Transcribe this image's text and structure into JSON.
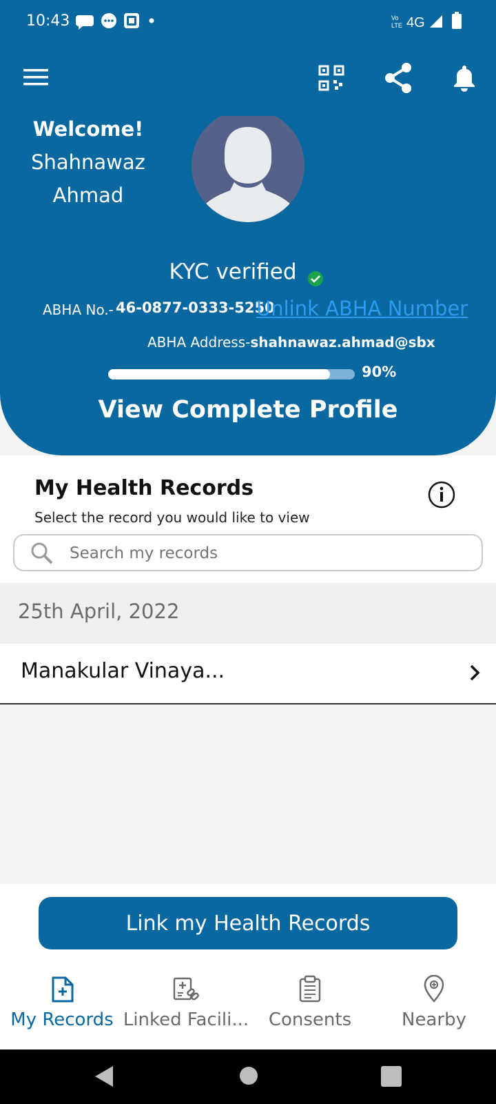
{
  "status_bar": {
    "time": "10:43",
    "network": "4G"
  },
  "profile": {
    "welcome": "Welcome!",
    "first_name": "Shahnawaz",
    "last_name": "Ahmad",
    "kyc": "KYC verified",
    "abha_no_label": "ABHA No.-",
    "abha_no": "46-0877-0333-5250",
    "unlink_label": "Unlink ABHA Number",
    "abha_address_label": "ABHA Address-",
    "abha_address": "shahnawaz.ahmad@sbx",
    "completion_percent": 90,
    "completion_label": "90%",
    "view_profile": "View Complete Profile"
  },
  "records": {
    "title": "My Health Records",
    "subtitle": "Select the record you would like to view",
    "search_placeholder": "Search my records",
    "groups": [
      {
        "date": "25th April, 2022",
        "items": [
          {
            "name": "Manakular Vinaya..."
          }
        ]
      }
    ],
    "link_button": "Link my Health Records"
  },
  "bottom_nav": [
    {
      "label": "My Records",
      "icon": "records-icon",
      "active": true
    },
    {
      "label": "Linked Facili...",
      "icon": "linked-facilities-icon",
      "active": false
    },
    {
      "label": "Consents",
      "icon": "consents-icon",
      "active": false
    },
    {
      "label": "Nearby",
      "icon": "nearby-icon",
      "active": false
    }
  ],
  "colors": {
    "primary": "#0a68a1",
    "link": "#2f9bf0",
    "verified": "#1aa34a",
    "active_nav": "#0a68a1",
    "inactive_nav": "#6a6a6a"
  }
}
